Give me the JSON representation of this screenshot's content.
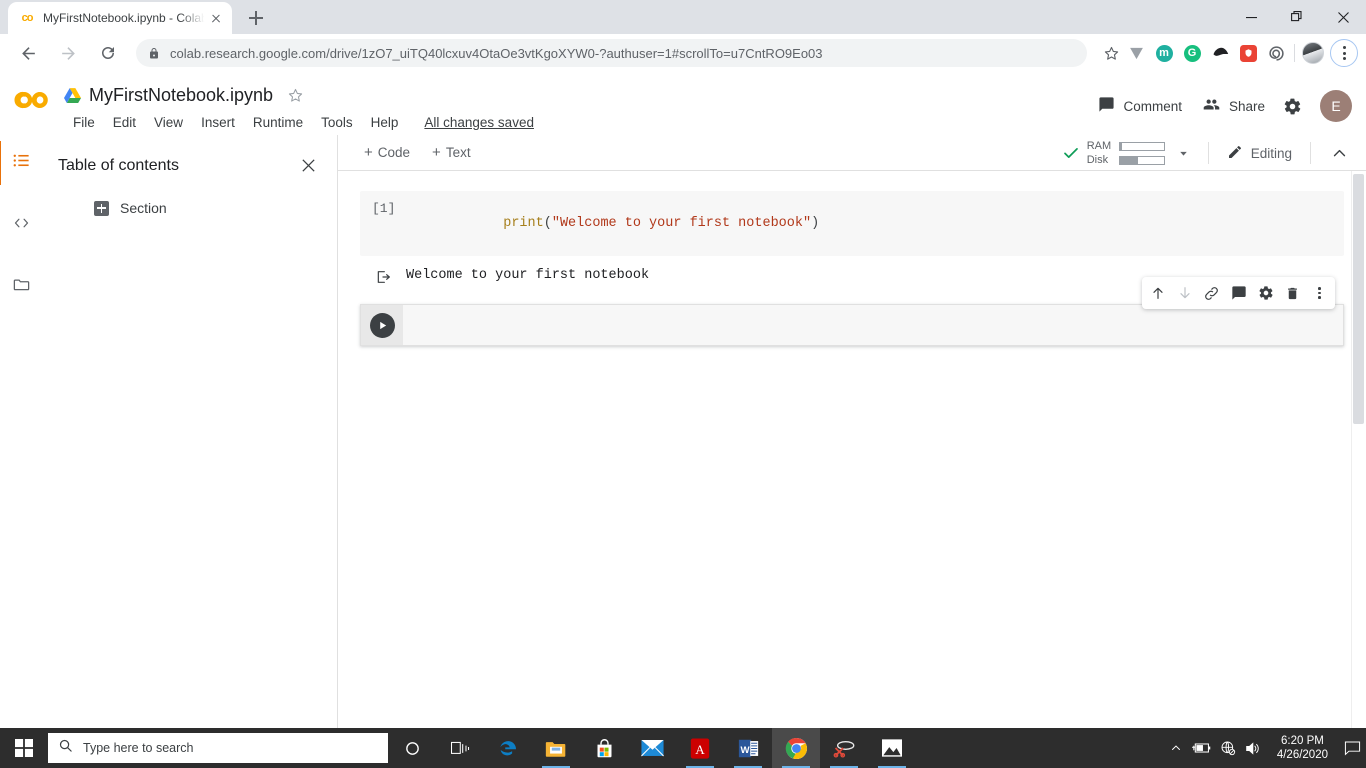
{
  "browser": {
    "tab": {
      "title": "MyFirstNotebook.ipynb - Colabo",
      "favicon": "colab-icon",
      "close": "close-tab-icon"
    },
    "new_tab": "new-tab-icon",
    "window": {
      "minimize": "minimize-icon",
      "restore": "restore-icon",
      "close": "close-icon"
    },
    "nav": {
      "back": "back-arrow-icon",
      "forward": "forward-arrow-icon",
      "reload": "reload-icon"
    },
    "omnibox": {
      "lock": "lock-icon",
      "url": "colab.research.google.com/drive/1zO7_uiTQ40lcxuv4OtaOe3vtKgoXYW0-?authuser=1#scrollTo=u7CntRO9Eo03",
      "star": "bookmark-star-icon"
    },
    "extensions": [
      {
        "name": "v-extension-icon",
        "letter": "",
        "color": "#9aa0a6"
      },
      {
        "name": "m-extension-icon",
        "letter": "m",
        "color": "#1fb0a0"
      },
      {
        "name": "g-extension-icon",
        "letter": "G",
        "color": "#17bf7e"
      },
      {
        "name": "blob-extension-icon",
        "letter": "",
        "color": "#202124"
      },
      {
        "name": "shield-extension-icon",
        "letter": "",
        "color": "#ea4335"
      },
      {
        "name": "swirl-extension-icon",
        "letter": "",
        "color": "#5f6368"
      }
    ],
    "profile_avatar": "profile-avatar-icon",
    "menu": "chrome-menu-icon"
  },
  "colab": {
    "logo": "colab-logo",
    "drive_icon": "google-drive-icon",
    "filename": "MyFirstNotebook.ipynb",
    "star": "star-icon",
    "menu_items": [
      "File",
      "Edit",
      "View",
      "Insert",
      "Runtime",
      "Tools",
      "Help"
    ],
    "save_status": "All changes saved",
    "comment_label": "Comment",
    "comment_icon": "comment-icon",
    "share_label": "Share",
    "share_icon": "people-icon",
    "settings_icon": "gear-icon",
    "avatar_letter": "E",
    "avatar_color": "#9c7f76"
  },
  "rail": {
    "items": [
      {
        "name": "sidebar-item-table-of-contents",
        "icon": "list-icon",
        "active": true
      },
      {
        "name": "sidebar-item-code-snippets",
        "icon": "code-brackets-icon",
        "active": false
      },
      {
        "name": "sidebar-item-files",
        "icon": "folder-icon",
        "active": false
      }
    ],
    "accent": "#e8710a"
  },
  "toc": {
    "title": "Table of contents",
    "close_icon": "close-icon",
    "entries": [
      {
        "label": "Section",
        "expand_icon": "expand-plus-icon"
      }
    ]
  },
  "notebook": {
    "toolbar": {
      "add_code": "Code",
      "add_text": "Text",
      "plus": "+",
      "status_icon": "checkmark-icon",
      "ram_label": "RAM",
      "ram_fill_pct": 6,
      "disk_label": "Disk",
      "disk_fill_pct": 42,
      "caret_icon": "chevron-down-icon",
      "edit_icon": "pencil-icon",
      "editing_label": "Editing",
      "collapse_icon": "chevron-up-icon"
    },
    "cells": [
      {
        "type": "code",
        "exec_count": "[1]",
        "tokens": [
          {
            "text": "print",
            "cls": "tok-fn"
          },
          {
            "text": "(",
            "cls": "tok-punc"
          },
          {
            "text": "\"Welcome to your first notebook\"",
            "cls": "tok-str"
          },
          {
            "text": ")",
            "cls": "tok-punc"
          }
        ]
      },
      {
        "type": "output",
        "icon": "output-arrow-icon",
        "text": "Welcome to your first notebook"
      },
      {
        "type": "empty-code",
        "run_icon": "run-play-icon"
      }
    ],
    "cell_toolbar": [
      {
        "name": "move-cell-up-button",
        "icon": "arrow-up-icon",
        "disabled": false
      },
      {
        "name": "move-cell-down-button",
        "icon": "arrow-down-icon",
        "disabled": true
      },
      {
        "name": "link-to-cell-button",
        "icon": "link-icon",
        "disabled": false
      },
      {
        "name": "add-comment-button",
        "icon": "comment-icon",
        "disabled": false
      },
      {
        "name": "cell-settings-button",
        "icon": "gear-icon",
        "disabled": false
      },
      {
        "name": "delete-cell-button",
        "icon": "trash-icon",
        "disabled": false
      },
      {
        "name": "more-cell-actions-button",
        "icon": "more-vertical-icon",
        "disabled": false
      }
    ]
  },
  "taskbar": {
    "start": "windows-start-icon",
    "search_placeholder": "Type here to search",
    "search_icon": "search-icon",
    "cortana": "cortana-icon",
    "apps": [
      {
        "name": "task-view-button",
        "icon": "task-view-icon",
        "running": false,
        "active": false
      },
      {
        "name": "taskbar-edge",
        "icon": "edge-icon",
        "running": false,
        "active": false
      },
      {
        "name": "taskbar-file-explorer",
        "icon": "file-explorer-icon",
        "running": true,
        "active": false
      },
      {
        "name": "taskbar-microsoft-store",
        "icon": "microsoft-store-icon",
        "running": false,
        "active": false
      },
      {
        "name": "taskbar-mail",
        "icon": "mail-icon",
        "running": false,
        "active": false
      },
      {
        "name": "taskbar-acrobat",
        "icon": "adobe-acrobat-icon",
        "running": true,
        "active": false
      },
      {
        "name": "taskbar-word",
        "icon": "word-icon",
        "running": true,
        "active": false
      },
      {
        "name": "taskbar-chrome",
        "icon": "chrome-icon",
        "running": true,
        "active": true
      },
      {
        "name": "taskbar-snipping-tool",
        "icon": "snipping-tool-icon",
        "running": true,
        "active": false
      },
      {
        "name": "taskbar-photos",
        "icon": "photos-icon",
        "running": true,
        "active": false
      }
    ],
    "tray": {
      "overflow": "chevron-up-icon",
      "battery": "battery-charging-icon",
      "network": "network-offline-icon",
      "volume": "speaker-icon",
      "time": "6:20 PM",
      "date": "4/26/2020",
      "action_center": "action-center-icon"
    }
  }
}
